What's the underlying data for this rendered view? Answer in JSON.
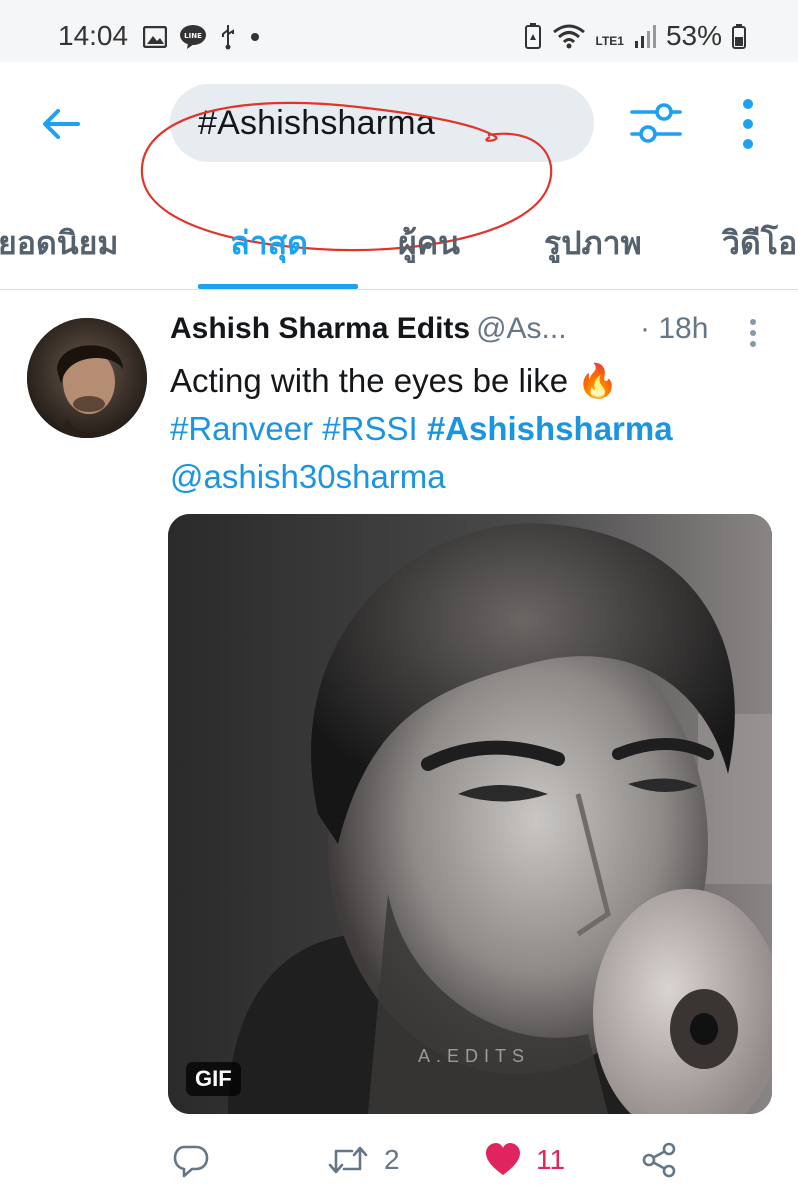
{
  "status_bar": {
    "time": "14:04",
    "battery": "53%",
    "network": "LTE1",
    "icons": [
      "image-icon",
      "line-icon",
      "usb-icon",
      "dot-icon",
      "battery-saver-icon",
      "wifi-icon",
      "signal-icon",
      "battery-icon"
    ]
  },
  "header": {
    "search_query": "#Ashishsharma",
    "back_icon": "back-arrow-icon",
    "filter_icon": "filter-icon",
    "more_icon": "more-vertical-icon",
    "annotation_color": "#e0352b"
  },
  "tabs": [
    {
      "label": "ยอดนิยม",
      "active": false
    },
    {
      "label": "ล่าสุด",
      "active": true
    },
    {
      "label": "ผู้คน",
      "active": false
    },
    {
      "label": "รูปภาพ",
      "active": false
    },
    {
      "label": "วิดีโอ",
      "active": false
    }
  ],
  "tweet": {
    "author_name": "Ashish Sharma Edits",
    "author_handle": "@As...",
    "time": "· 18h",
    "text": "Acting with the eyes be like 🔥",
    "hashtags": [
      "#Ranveer",
      "#RSSI",
      "#Ashishsharma"
    ],
    "mention": "@ashish30sharma",
    "media_badge": "GIF",
    "media_watermark": "A.EDITS",
    "replies": "",
    "retweets": "2",
    "likes": "11",
    "liked": true
  },
  "colors": {
    "accent": "#1da1f2",
    "like": "#e0245e",
    "muted": "#657786"
  }
}
